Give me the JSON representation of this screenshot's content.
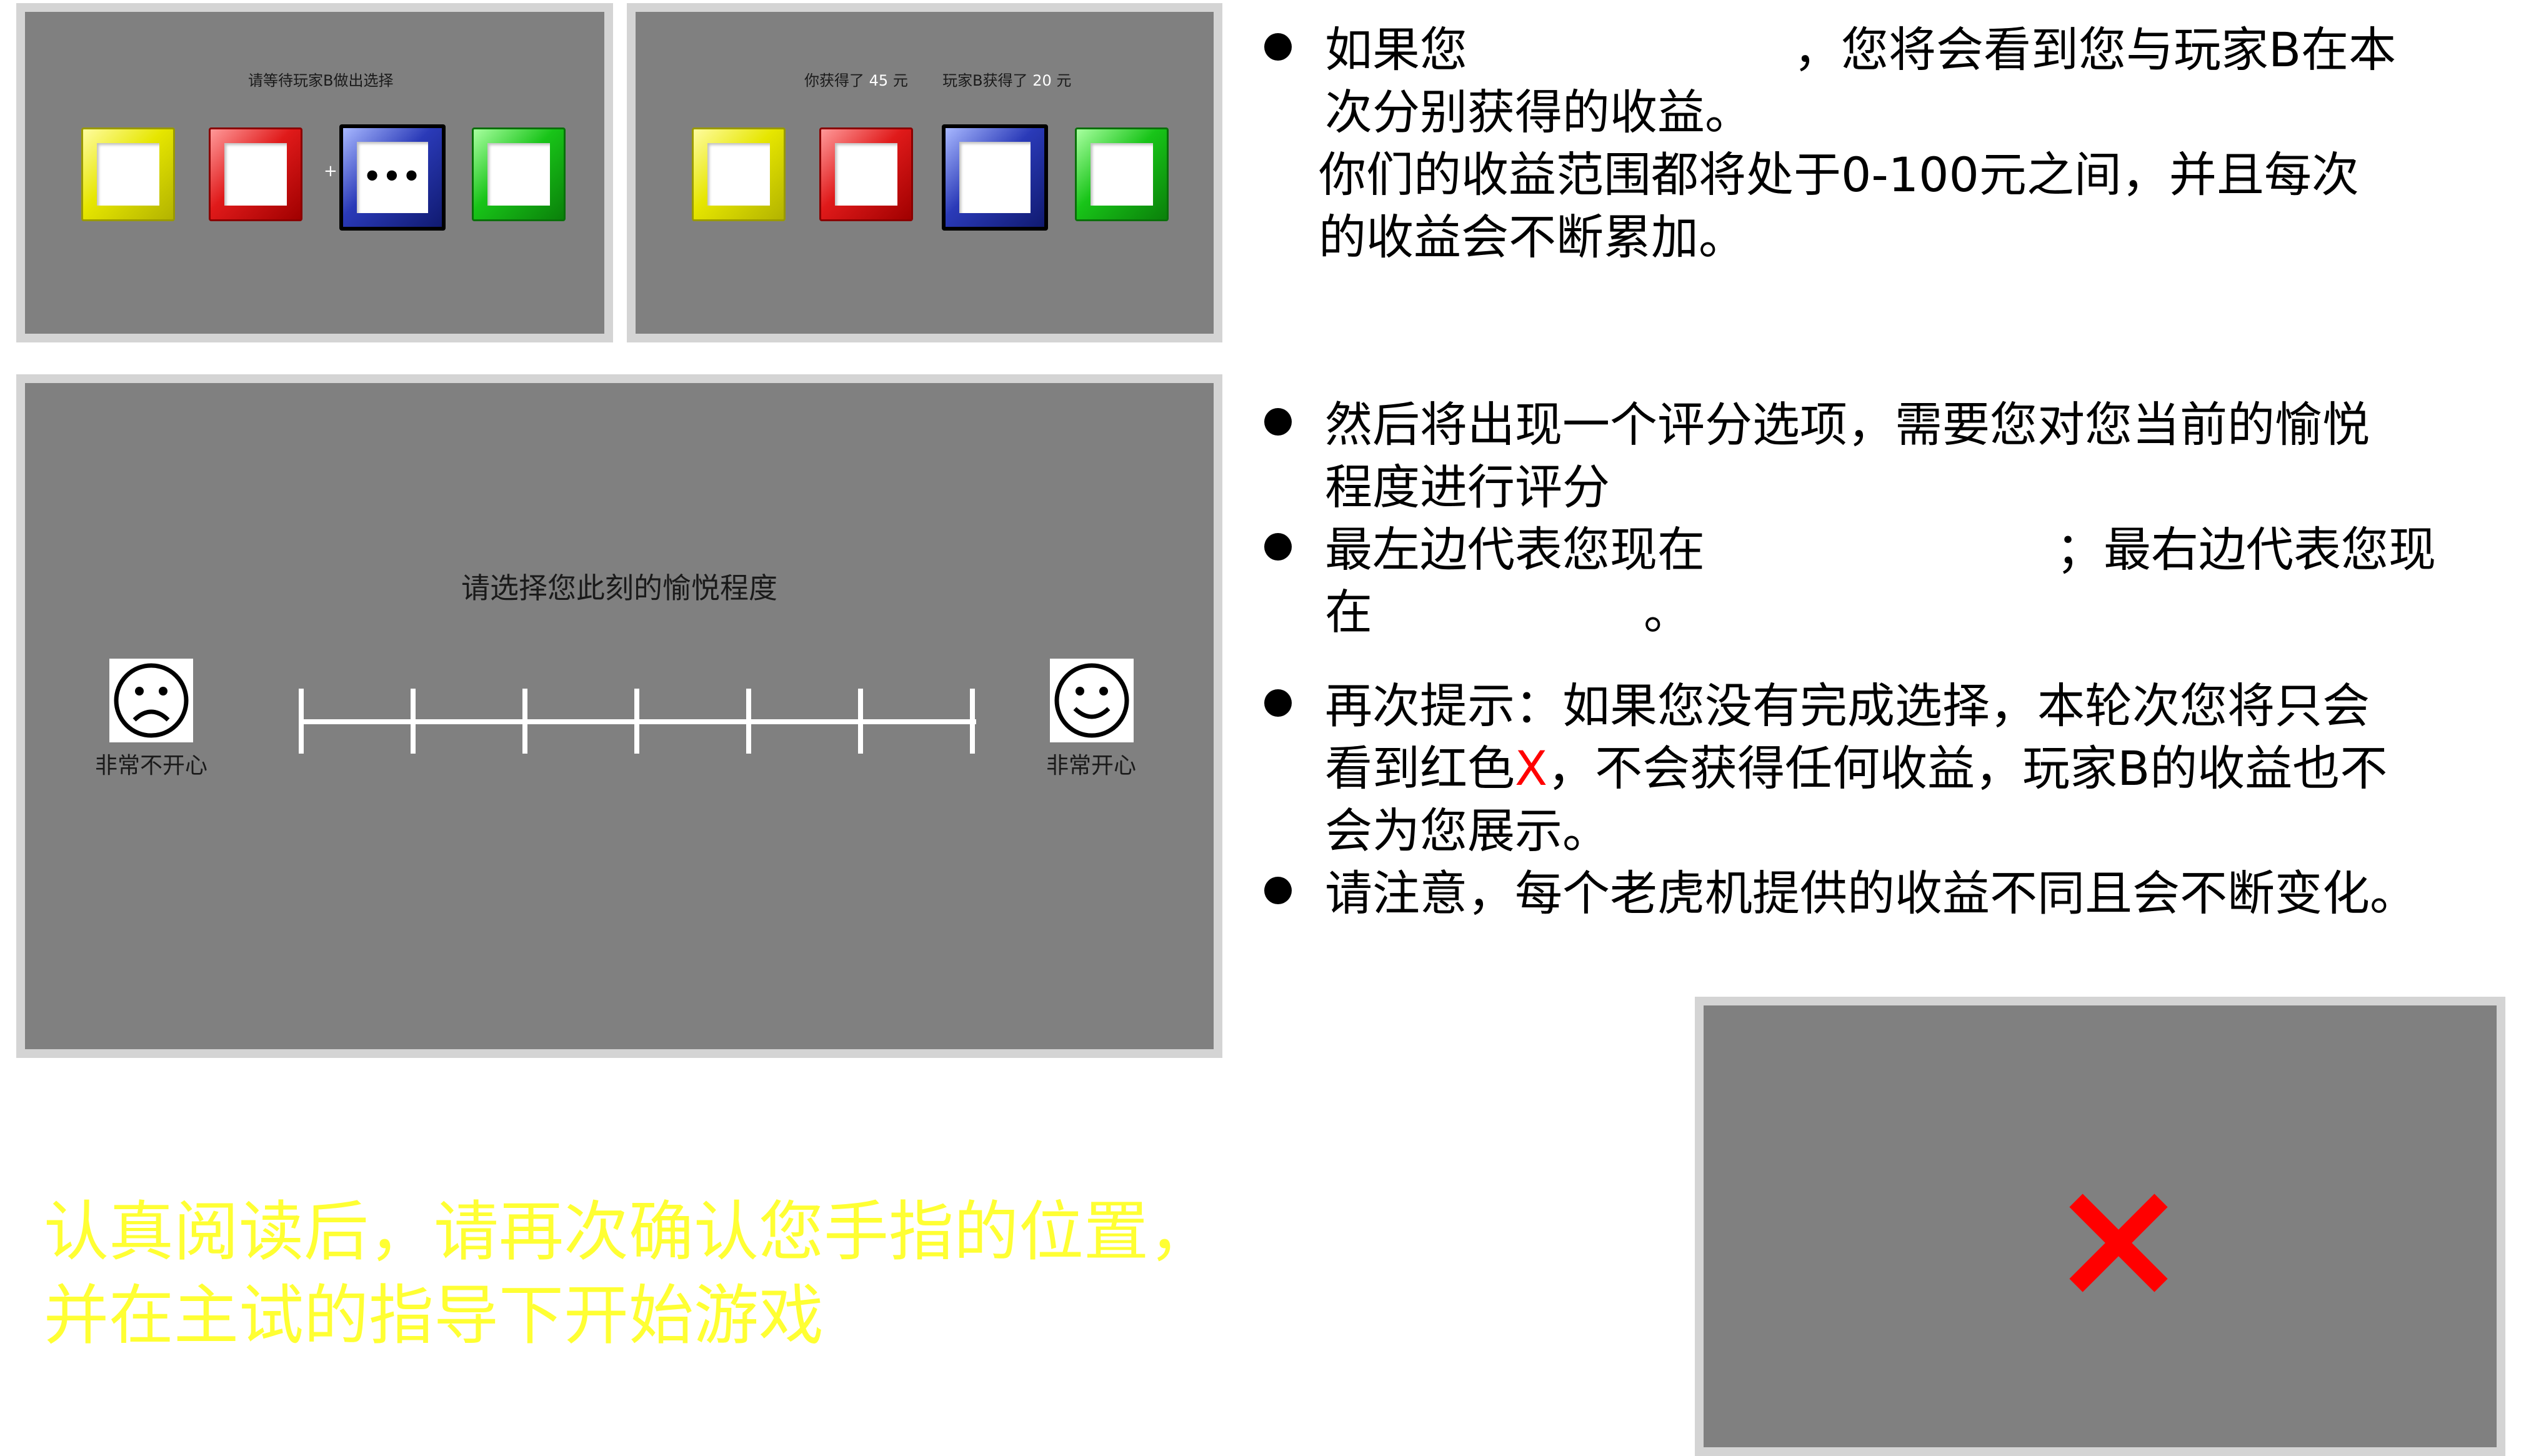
{
  "panel_wait": {
    "prompt": "请等待玩家B做出选择",
    "plus": "+",
    "dots": "•••"
  },
  "panel_result": {
    "you_prefix": "你获得了",
    "you_value": "45",
    "you_unit": "元",
    "b_prefix": "玩家B获得了",
    "b_value": "20",
    "b_unit": "元"
  },
  "panel_rating": {
    "title": "请选择您此刻的愉悦程度",
    "left_label": "非常不开心",
    "right_label": "非常开心",
    "left_face": "☹",
    "right_face": "☺",
    "tick_count": 7
  },
  "instructions": {
    "b1_l1a": "如果您",
    "b1_l1b": "，您将会看到您与玩家B在本",
    "b1_l2": "次分别获得的收益。",
    "b1_l3": "你们的收益范围都将处于0-100元之间，并且每次",
    "b1_l4": "的收益会不断累加。",
    "b2_l1": "然后将出现一个评分选项，需要您对您当前的愉悦",
    "b2_l2": "程度进行评分",
    "b3_l1a": "最左边代表您现在",
    "b3_l1b": "；最右边代表您现",
    "b3_l2a": "在",
    "b3_l2b": "。",
    "b4_l1": "再次提示：如果您没有完成选择，本轮次您将只会",
    "b4_l2a": "看到红色",
    "b4_l2x": "X",
    "b4_l2b": "，不会获得任何收益，玩家B的收益也不",
    "b4_l3": "会为您展示。",
    "b5_l1": "请注意，每个老虎机提供的收益不同且会不断变化。"
  },
  "confirm": {
    "line1": "认真阅读后，请再次确认您手指的位置，",
    "line2": "并在主试的指导下开始游戏"
  },
  "colors": {
    "panel_bg": "#808080",
    "panel_border": "#d4d4d4",
    "confirm_text": "#ffff33",
    "red_x": "#ff0000"
  }
}
